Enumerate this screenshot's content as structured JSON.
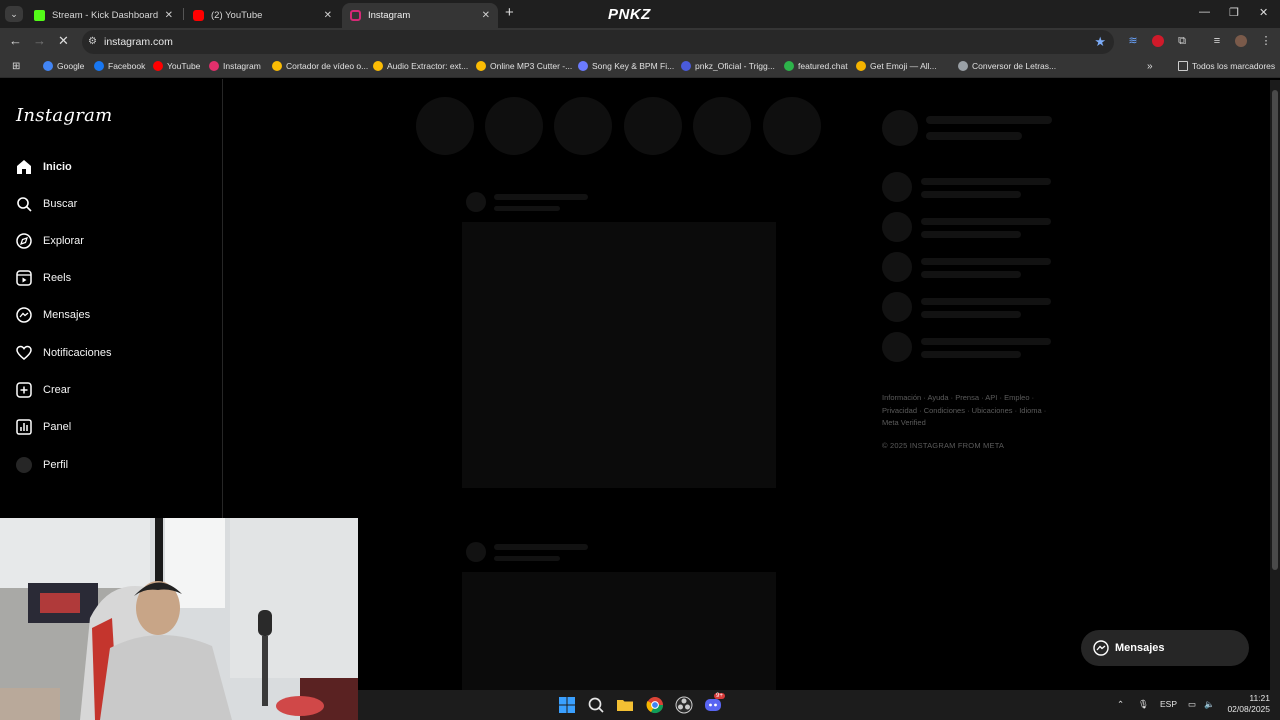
{
  "browser": {
    "tabs": [
      {
        "title": "Stream - Kick Dashboard",
        "icon": "kick-icon"
      },
      {
        "title": "(2) YouTube",
        "icon": "youtube-icon"
      },
      {
        "title": "Instagram",
        "icon": "instagram-icon"
      }
    ],
    "window_title_overlay": "PNKZ",
    "url": "instagram.com",
    "bookmarks": [
      {
        "label": "Google",
        "color": "#4285f4"
      },
      {
        "label": "Facebook",
        "color": "#1877f2"
      },
      {
        "label": "YouTube",
        "color": "#ff0000"
      },
      {
        "label": "Instagram",
        "color": "#e1306c"
      },
      {
        "label": "Cortador de vídeo o...",
        "color": "#fbbc04"
      },
      {
        "label": "Audio Extractor: ext...",
        "color": "#fbbc04"
      },
      {
        "label": "Online MP3 Cutter -...",
        "color": "#fbbc04"
      },
      {
        "label": "Song Key & BPM Fi...",
        "color": "#6b7bff"
      },
      {
        "label": "pnkz_Oficial - Trigg...",
        "color": "#4a5bdc"
      },
      {
        "label": "featured.chat",
        "color": "#2db34a"
      },
      {
        "label": "Get Emoji — All...",
        "color": "#f5b400"
      },
      {
        "label": "Conversor de Letras...",
        "color": "#9aa0a6"
      }
    ],
    "all_bookmarks_label": "Todos los marcadores"
  },
  "instagram": {
    "logo": "Instagram",
    "nav": [
      {
        "label": "Inicio",
        "icon": "home-icon"
      },
      {
        "label": "Buscar",
        "icon": "search-icon"
      },
      {
        "label": "Explorar",
        "icon": "compass-icon"
      },
      {
        "label": "Reels",
        "icon": "reels-icon"
      },
      {
        "label": "Mensajes",
        "icon": "messenger-icon"
      },
      {
        "label": "Notificaciones",
        "icon": "heart-icon"
      },
      {
        "label": "Crear",
        "icon": "plus-square-icon"
      },
      {
        "label": "Panel",
        "icon": "chart-icon"
      },
      {
        "label": "Perfil",
        "icon": "avatar"
      }
    ],
    "footer_links": [
      "Información",
      "Ayuda",
      "Prensa",
      "API",
      "Empleo",
      "Privacidad",
      "Condiciones",
      "Ubicaciones",
      "Idioma",
      "Meta Verified"
    ],
    "copyright": "© 2025 INSTAGRAM FROM META",
    "messages_button": "Mensajes"
  },
  "taskbar": {
    "language": "ESP",
    "time": "11:21",
    "date": "02/08/2025",
    "discord_badge": "9+"
  }
}
